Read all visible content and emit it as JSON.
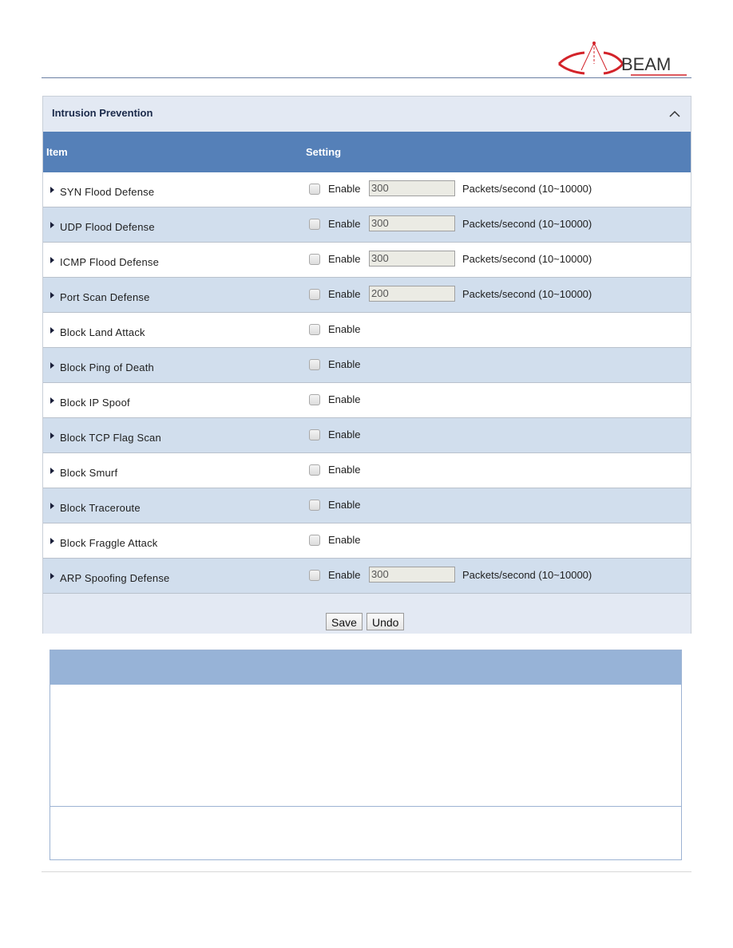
{
  "brand": {
    "logo_text": "BEAM",
    "logo_color": "#d3232a",
    "icon": "beam-antenna-logo-icon"
  },
  "panel": {
    "title": "Intrusion Prevention",
    "collapse_icon": "chevron-up-icon",
    "columns": {
      "item": "Item",
      "setting": "Setting"
    },
    "rows": [
      {
        "label": "SYN Flood Defense",
        "enable_label": "Enable",
        "enabled": false,
        "value": "300",
        "unit": "Packets/second (10~10000)"
      },
      {
        "label": "UDP Flood Defense",
        "enable_label": "Enable",
        "enabled": false,
        "value": "300",
        "unit": "Packets/second (10~10000)"
      },
      {
        "label": "ICMP Flood Defense",
        "enable_label": "Enable",
        "enabled": false,
        "value": "300",
        "unit": "Packets/second (10~10000)"
      },
      {
        "label": "Port Scan Defense",
        "enable_label": "Enable",
        "enabled": false,
        "value": "200",
        "unit": "Packets/second (10~10000)"
      },
      {
        "label": "Block Land Attack",
        "enable_label": "Enable",
        "enabled": false
      },
      {
        "label": "Block Ping of Death",
        "enable_label": "Enable",
        "enabled": false
      },
      {
        "label": "Block IP Spoof",
        "enable_label": "Enable",
        "enabled": false
      },
      {
        "label": "Block TCP Flag Scan",
        "enable_label": "Enable",
        "enabled": false
      },
      {
        "label": "Block Smurf",
        "enable_label": "Enable",
        "enabled": false
      },
      {
        "label": "Block Traceroute",
        "enable_label": "Enable",
        "enabled": false
      },
      {
        "label": "Block Fraggle Attack",
        "enable_label": "Enable",
        "enabled": false
      },
      {
        "label": "ARP Spoofing Defense",
        "enable_label": "Enable",
        "enabled": false,
        "value": "300",
        "unit": "Packets/second (10~10000)"
      }
    ],
    "buttons": {
      "save": "Save",
      "undo": "Undo"
    }
  },
  "colors": {
    "table_header": "#5580b8",
    "row_alt": "#d1deed",
    "panel_bg": "#e3e9f3",
    "info_header": "#97b3d7"
  }
}
